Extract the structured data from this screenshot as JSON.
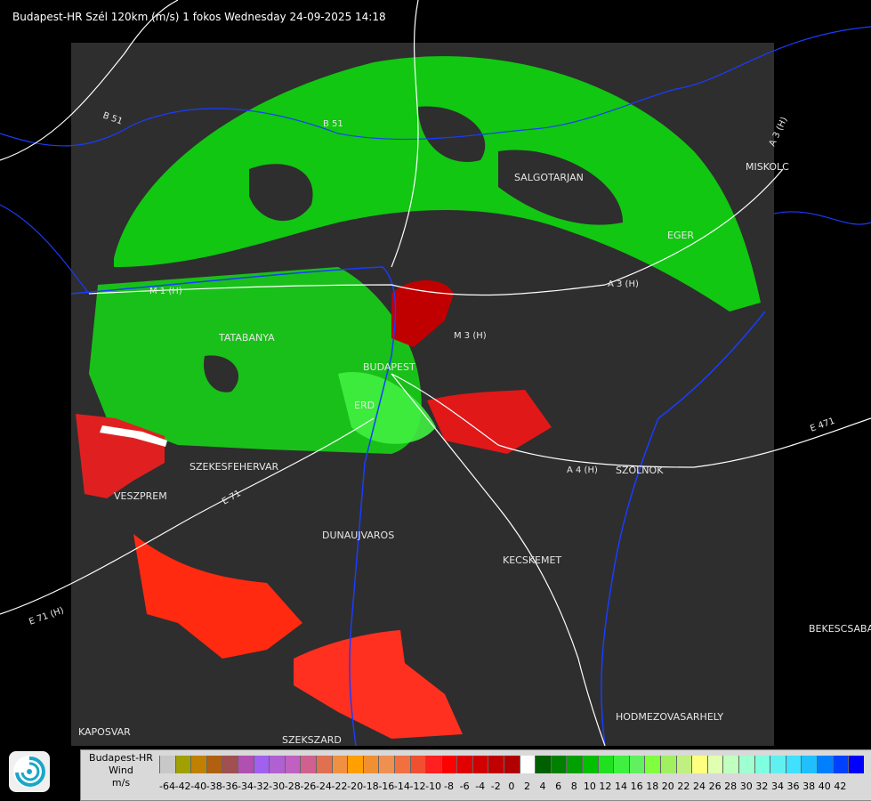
{
  "header": {
    "title": "Budapest-HR Szél 120km (m/s) 1 fokos Wednesday 24-09-2025 14:18"
  },
  "map": {
    "cities": [
      "SALGOTARJAN",
      "MISKOLC",
      "EGER",
      "TATABANYA",
      "BUDAPEST",
      "ERD",
      "SZEKESFEHERVAR",
      "VESZPREM",
      "DUNAUJVAROS",
      "KECSKEMET",
      "SZOLNOK",
      "BEKESCSABA",
      "KAPOSVAR",
      "SZEKSZARD",
      "HODMEZOVASARHELY"
    ],
    "roads": [
      "B 51",
      "B 51",
      "M 1 (H)",
      "M 3 (H)",
      "A 3 (H)",
      "A 3 (H)",
      "E 471",
      "A 4 (H)",
      "E 71",
      "E 71 (H)"
    ]
  },
  "legend": {
    "title": "Budapest-HR",
    "quantity": "Wind",
    "unit": "m/s",
    "colors": [
      "#c8c8c8",
      "#a0a000",
      "#c08000",
      "#b06010",
      "#a05050",
      "#b050b0",
      "#a060f0",
      "#b060d0",
      "#c060c0",
      "#d06090",
      "#e07050",
      "#f09040",
      "#ffa000",
      "#f09030",
      "#f09050",
      "#f07040",
      "#f05030",
      "#ff2020",
      "#ff0000",
      "#e00000",
      "#d00000",
      "#c00000",
      "#b00000",
      "#ffffff",
      "#006000",
      "#008000",
      "#00a000",
      "#00c000",
      "#20e020",
      "#40f040",
      "#60f060",
      "#80ff40",
      "#a0f060",
      "#c0f080",
      "#ffff80",
      "#e0ffb0",
      "#c0ffc0",
      "#a0ffd0",
      "#80ffe0",
      "#60f0f0",
      "#40e0ff",
      "#20c0ff",
      "#0080ff",
      "#0040ff",
      "#0000ff"
    ],
    "ticks": [
      "-64",
      "-42",
      "-40",
      "-38",
      "-36",
      "-34",
      "-32",
      "-30",
      "-28",
      "-26",
      "-24",
      "-22",
      "-20",
      "-18",
      "-16",
      "-14",
      "-12",
      "-10",
      "-8",
      "-6",
      "-4",
      "-2",
      "0",
      "2",
      "4",
      "6",
      "8",
      "10",
      "12",
      "14",
      "16",
      "18",
      "20",
      "22",
      "24",
      "26",
      "28",
      "30",
      "32",
      "34",
      "36",
      "38",
      "40",
      "42"
    ]
  }
}
